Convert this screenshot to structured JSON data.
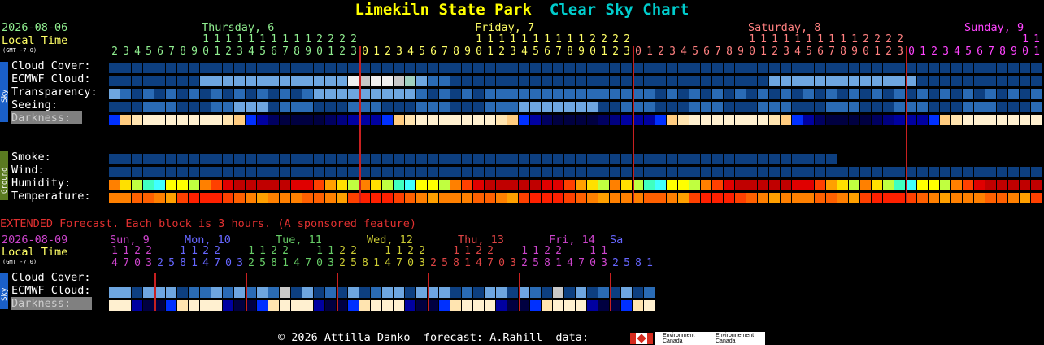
{
  "title": {
    "location": "Limekiln State Park",
    "chart_name": "Clear Sky Chart"
  },
  "header": {
    "date": "2026-08-06",
    "local_time_label": "Local Time",
    "gmt_label": "(GMT -7.0)",
    "days": [
      {
        "label": "Thursday, 6",
        "color": "#90ee90"
      },
      {
        "label": "Friday, 7",
        "color": "#ffff66"
      },
      {
        "label": "Saturday, 8",
        "color": "#ff8080"
      },
      {
        "label": "Sunday, 9",
        "color": "#ff44ff"
      }
    ],
    "hour_tens": [
      "",
      "",
      "",
      "",
      "",
      "",
      "",
      "",
      "1",
      "1",
      "1",
      "1",
      "1",
      "1",
      "1",
      "1",
      "1",
      "1",
      "2",
      "2",
      "2",
      "2",
      "",
      "",
      "",
      "",
      "",
      "",
      "",
      "",
      "",
      "",
      "1",
      "1",
      "1",
      "1",
      "1",
      "1",
      "1",
      "1",
      "1",
      "1",
      "2",
      "2",
      "2",
      "2",
      "",
      "",
      "",
      "",
      "",
      "",
      "",
      "",
      "",
      "",
      "1",
      "1",
      "1",
      "1",
      "1",
      "1",
      "1",
      "1",
      "1",
      "1",
      "2",
      "2",
      "2",
      "2",
      "",
      "",
      "",
      "",
      "",
      "",
      "",
      "",
      "",
      "",
      "1",
      "1"
    ],
    "hour_ones": [
      "2",
      "3",
      "4",
      "5",
      "6",
      "7",
      "8",
      "9",
      "0",
      "1",
      "2",
      "3",
      "4",
      "5",
      "6",
      "7",
      "8",
      "9",
      "0",
      "1",
      "2",
      "3",
      "0",
      "1",
      "2",
      "3",
      "4",
      "5",
      "6",
      "7",
      "8",
      "9",
      "0",
      "1",
      "2",
      "3",
      "4",
      "5",
      "6",
      "7",
      "8",
      "9",
      "0",
      "1",
      "2",
      "3",
      "0",
      "1",
      "2",
      "3",
      "4",
      "5",
      "6",
      "7",
      "8",
      "9",
      "0",
      "1",
      "2",
      "3",
      "4",
      "5",
      "6",
      "7",
      "8",
      "9",
      "0",
      "1",
      "2",
      "3",
      "0",
      "1",
      "2",
      "3",
      "4",
      "5",
      "6",
      "7",
      "8",
      "9",
      "0",
      "1"
    ]
  },
  "rows": {
    "cloud": {
      "label": "Cloud Cover:"
    },
    "ecmwf": {
      "label": "ECMWF Cloud:"
    },
    "transparency": {
      "label": "Transparency:"
    },
    "seeing": {
      "label": "Seeing:"
    },
    "darkness": {
      "label": "Darkness:"
    },
    "smoke": {
      "label": "Smoke:"
    },
    "wind": {
      "label": "Wind:"
    },
    "humidity": {
      "label": "Humidity:"
    },
    "temperature": {
      "label": "Temperature:"
    }
  },
  "side_labels": {
    "sky": "Sky",
    "ground": "Ground",
    "sky2": "Sky"
  },
  "extended": {
    "notice": "EXTENDED Forecast. Each block is 3 hours. (A sponsored feature)",
    "date": "2026-08-09",
    "local_time_label": "Local Time",
    "gmt_label": "(GMT -7.0)",
    "days": [
      {
        "label": "Sun, 9",
        "color": "#cc44cc"
      },
      {
        "label": "Mon, 10",
        "color": "#6666ff"
      },
      {
        "label": "Tue, 11",
        "color": "#66cc66"
      },
      {
        "label": "Wed, 12",
        "color": "#cccc33"
      },
      {
        "label": "Thu, 13",
        "color": "#dd4444"
      },
      {
        "label": "Fri, 14",
        "color": "#cc44cc"
      },
      {
        "label": "Sa",
        "color": "#6666ff"
      }
    ],
    "hour_tens": [
      "1",
      "1",
      "2",
      "2",
      "",
      "",
      "1",
      "1",
      "2",
      "2",
      "",
      "",
      "1",
      "1",
      "2",
      "2",
      "",
      "",
      "1",
      "1",
      "2",
      "2",
      "",
      "",
      "1",
      "1",
      "2",
      "2",
      "",
      "",
      "1",
      "1",
      "2",
      "2",
      "",
      "",
      "1",
      "1",
      "2",
      "2",
      "",
      "",
      "1",
      "1"
    ],
    "hour_ones": [
      "4",
      "7",
      "0",
      "3",
      "2",
      "5",
      "8",
      "1",
      "4",
      "7",
      "0",
      "3",
      "2",
      "5",
      "8",
      "1",
      "4",
      "7",
      "0",
      "3",
      "2",
      "5",
      "8",
      "1",
      "4",
      "7",
      "0",
      "3",
      "2",
      "5",
      "8",
      "1",
      "4",
      "7",
      "0",
      "3",
      "2",
      "5",
      "8",
      "1",
      "4",
      "7",
      "0",
      "3",
      "2",
      "5",
      "8",
      "1"
    ],
    "rows": {
      "cloud": {
        "label": "Cloud Cover:"
      },
      "ecmwf": {
        "label": "ECMWF Cloud:"
      },
      "darkness": {
        "label": "Darkness:"
      }
    }
  },
  "footer": {
    "copyright": "© 2026 Attilla Danko",
    "forecast": "forecast: A.Rahill",
    "data": "data:",
    "logo1": "Environment Canada",
    "logo2": "Environnement Canada"
  },
  "colors": {
    "title_yellow": "#ffff00",
    "title_cyan": "#00cccc",
    "midnight_line": "#c82020",
    "cloud_dark_blue": "#0d3f80",
    "cloud_medium_blue": "#2a6bb5",
    "cloud_light_blue": "#6ea6e0",
    "cloud_overcast": "#f0f0f0"
  }
}
